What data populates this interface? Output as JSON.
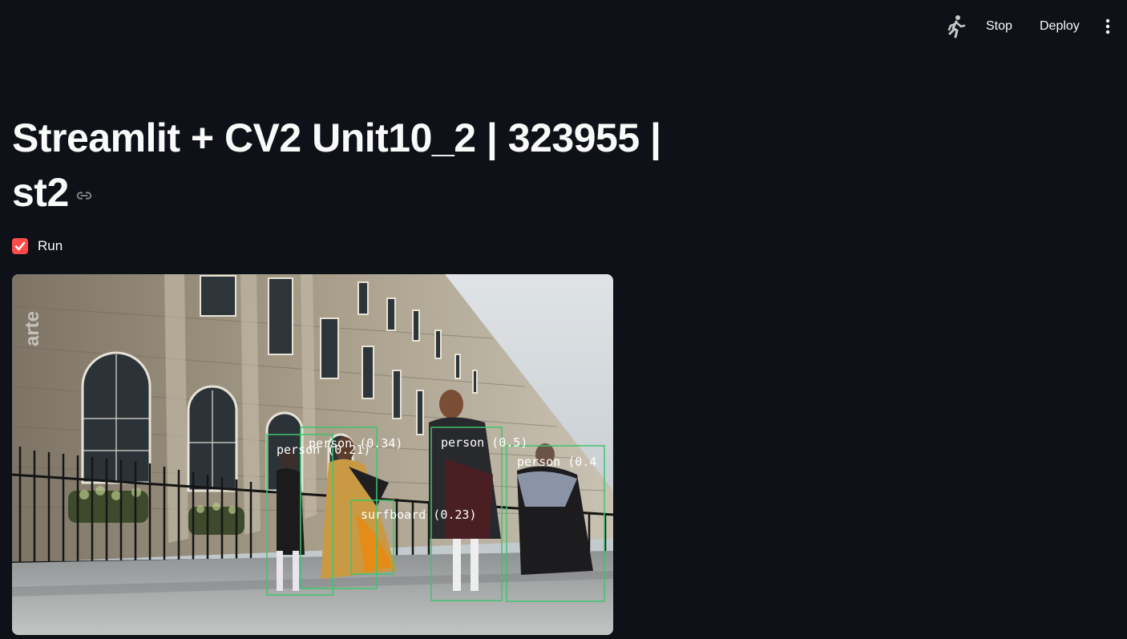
{
  "toolbar": {
    "running_icon": "running-man-icon",
    "stop_label": "Stop",
    "deploy_label": "Deploy",
    "menu_icon": "kebab-menu-icon"
  },
  "page": {
    "title": "Streamlit + CV2 Unit10_2 | 323955 | st2",
    "anchor_icon": "link-icon"
  },
  "run_checkbox": {
    "label": "Run",
    "checked": true
  },
  "video": {
    "watermark": "arte",
    "detections": [
      {
        "label": "person (0.21)"
      },
      {
        "label": "person (0.34)"
      },
      {
        "label": "person (0.5)"
      },
      {
        "label": "person (0.4"
      },
      {
        "label": "surfboard (0.23)"
      }
    ]
  },
  "colors": {
    "background": "#0e1117",
    "accent": "#ff4b4b",
    "box": "#3ec46d"
  }
}
